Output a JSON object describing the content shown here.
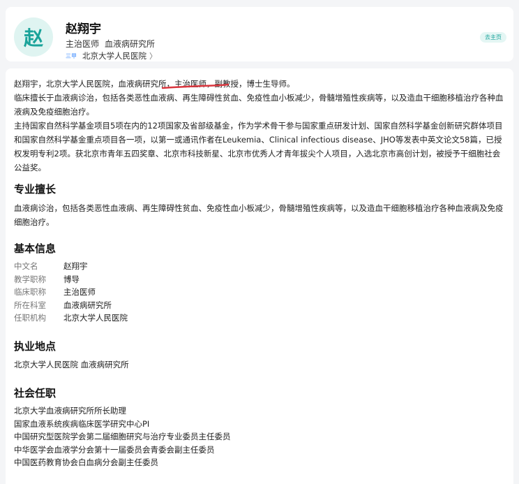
{
  "header": {
    "avatar_char": "赵",
    "name": "赵翔宇",
    "title": "主治医师",
    "department": "血液病研究所",
    "grade": "三甲",
    "hospital": "北京大学人民医院",
    "chevron": "〉",
    "homepage_label": "去主页"
  },
  "intro": {
    "lines": [
      "赵翔宇，北京大学人民医院，血液病研究所，主治医师，副教授，博士生导师。",
      "临床擅长于血液病诊治，包括各类恶性血液病、再生障碍性贫血、免疫性血小板减少，骨髓增殖性疾病等，以及造血干细胞移植治疗各种血液病及免疫细胞治疗。",
      "主持国家自然科学基金项目5项在内的12项国家及省部级基金，作为学术骨干参与国家重点研发计划、国家自然科学基金创新研究群体项目和国家自然科学基金重点项目各一项，以第一或通讯作者在Leukemia、Clinical infectious disease、JHO等发表中英文论文58篇，已授权发明专利2项。获北京市青年五四奖章、北京市科技新星、北京市优秀人才青年拔尖个人项目，入选北京市高创计划，被授予干细胞社会公益奖。"
    ]
  },
  "specialty": {
    "title": "专业擅长",
    "text": "血液病诊治，包括各类恶性血液病、再生障碍性贫血、免疫性血小板减少，骨髓增殖性疾病等，以及造血干细胞移植治疗各种血液病及免疫细胞治疗。"
  },
  "basic_info": {
    "title": "基本信息",
    "rows": [
      {
        "key": "中文名",
        "value": "赵翔宇"
      },
      {
        "key": "教学职称",
        "value": "博导"
      },
      {
        "key": "临床职称",
        "value": "主治医师"
      },
      {
        "key": "所在科室",
        "value": "血液病研究所"
      },
      {
        "key": "任职机构",
        "value": "北京大学人民医院"
      }
    ]
  },
  "practice": {
    "title": "执业地点",
    "text": "北京大学人民医院 血液病研究所"
  },
  "social": {
    "title": "社会任职",
    "items": [
      "北京大学血液病研究所所长助理",
      "国家血液系统疾病临床医学研究中心PI",
      "中国研究型医院学会第二届细胞研究与治疗专业委员主任委员",
      "中华医学会血液学分会第十一届委员会青委会副主任委员",
      "中国医药教育协会白血病分会副主任委员"
    ]
  },
  "colors": {
    "accent": "#1aa39a",
    "annotation_red": "#d9363e"
  }
}
